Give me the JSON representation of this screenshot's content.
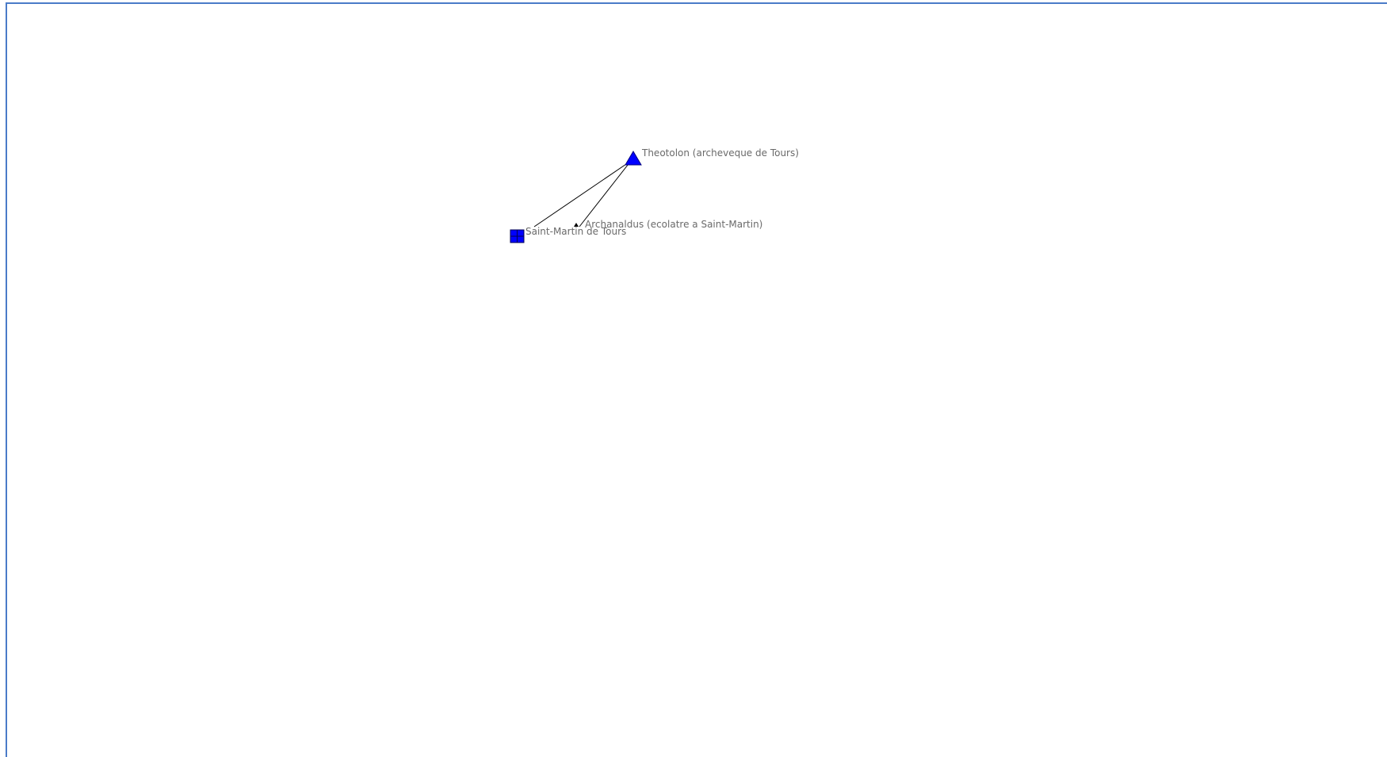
{
  "network": {
    "nodes": [
      {
        "id": "theotolon",
        "label": "Theotolon (archeveque de Tours)",
        "shape": "triangle",
        "color": "#0000ff"
      },
      {
        "id": "archanaldus",
        "label": "Archanaldus (ecolatre a Saint-Martin)",
        "shape": "small-triangle",
        "color": "#000000"
      },
      {
        "id": "saint-martin",
        "label": "Saint-Martin de Tours",
        "shape": "square",
        "color": "#0000ff"
      }
    ],
    "edges": [
      {
        "source": "theotolon",
        "target": "saint-martin"
      },
      {
        "source": "theotolon",
        "target": "archanaldus"
      }
    ],
    "colors": {
      "frame_border": "#4a7bc8",
      "edge": "#000000",
      "label": "#6a6a6a",
      "node_fill": "#0000ff"
    }
  }
}
